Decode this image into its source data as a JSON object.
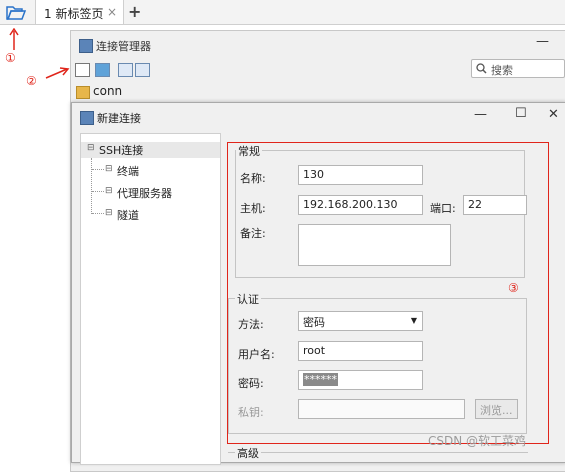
{
  "tabbar": {
    "tab_label": "1 新标签页",
    "tab_close": "×",
    "add": "+"
  },
  "annotations": {
    "n1": "①",
    "n2": "②",
    "n3": "③"
  },
  "manager": {
    "title": "连接管理器",
    "minimize": "—",
    "search_placeholder": "搜索",
    "tree_item": "conn"
  },
  "dialog": {
    "title": "新建连接",
    "minimize": "—",
    "maximize": "☐",
    "close": "✕",
    "tree": [
      "SSH连接",
      "终端",
      "代理服务器",
      "隧道"
    ],
    "groups": {
      "general": "常规",
      "auth": "认证",
      "advanced": "高级"
    },
    "labels": {
      "name": "名称:",
      "host": "主机:",
      "port": "端口:",
      "note": "备注:",
      "method": "方法:",
      "user": "用户名:",
      "password": "密码:",
      "key": "私钥:"
    },
    "values": {
      "name": "130",
      "host": "192.168.200.130",
      "port": "22",
      "method": "密码",
      "user": "root",
      "password": "******"
    },
    "browse": "浏览..."
  },
  "watermark": "CSDN @软工菜鸡",
  "colors": {
    "annotation": "#e0251b",
    "folder": "#e7b64a"
  }
}
